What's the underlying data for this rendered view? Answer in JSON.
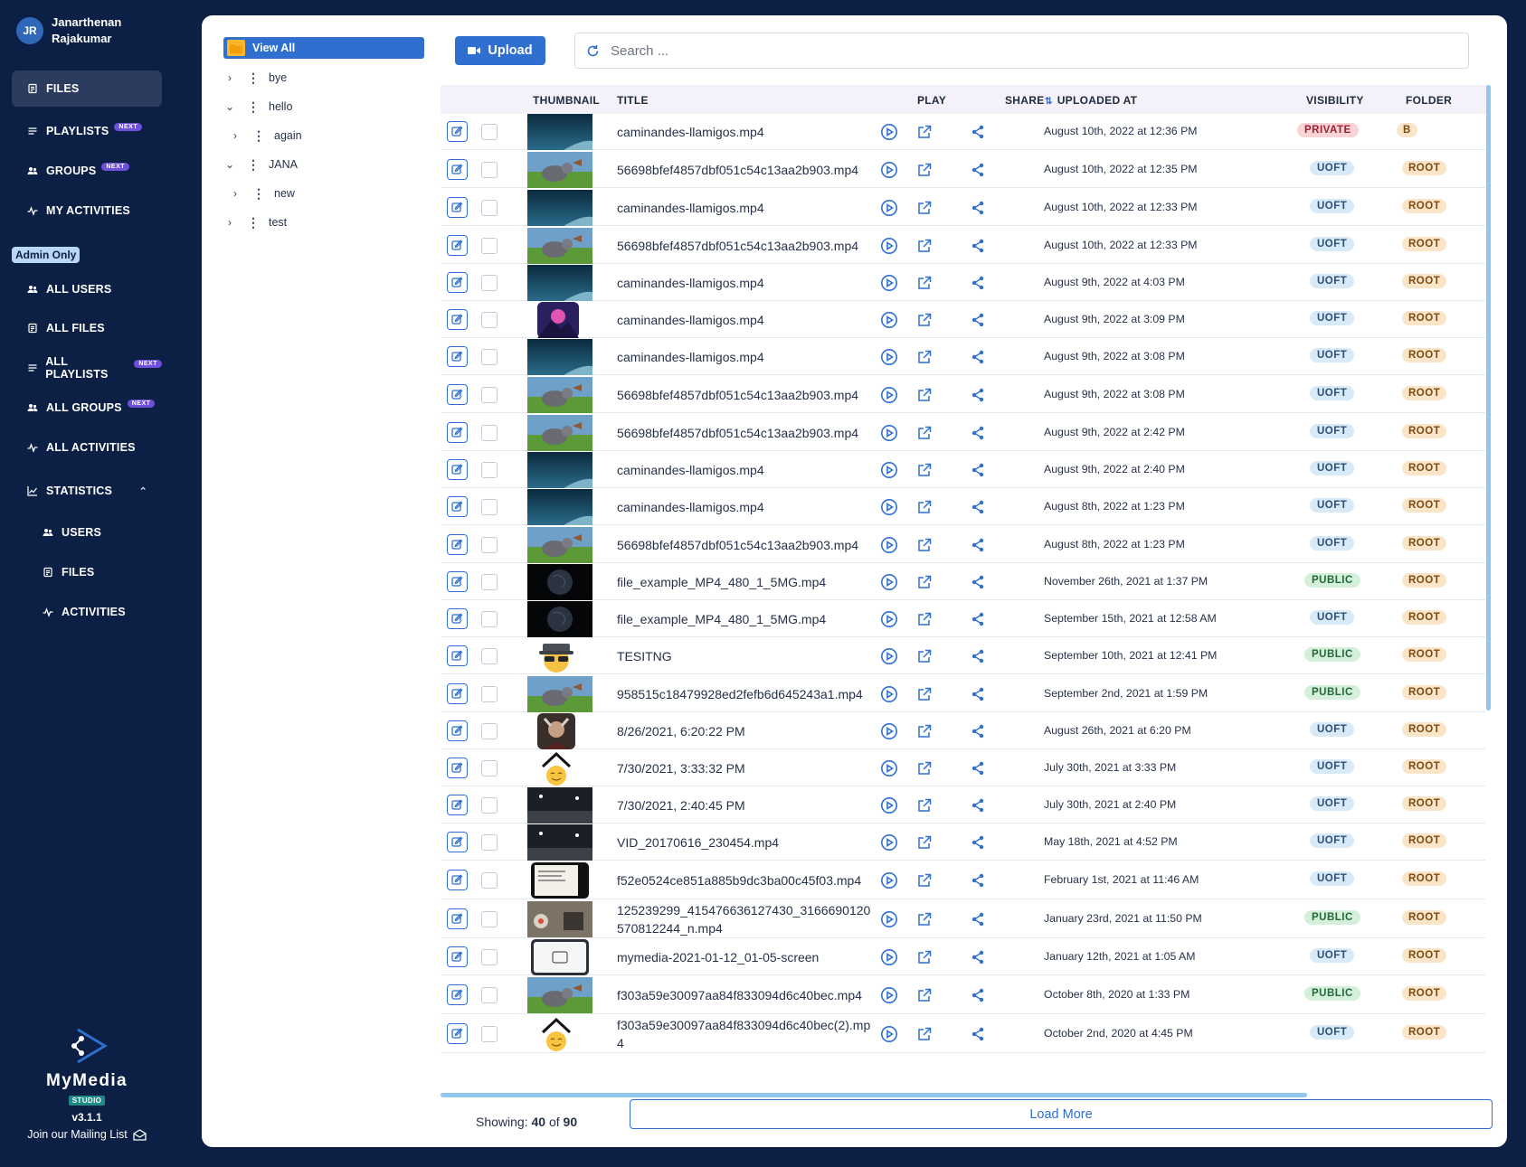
{
  "user": {
    "initials": "JR",
    "name": "Janarthenan Rajakumar"
  },
  "nav": {
    "files": "FILES",
    "playlists": "PLAYLISTS",
    "groups": "GROUPS",
    "my_activities": "MY ACTIVITIES",
    "admin_only": "Admin Only",
    "all_users": "ALL USERS",
    "all_files": "ALL FILES",
    "all_playlists": "ALL PLAYLISTS",
    "all_groups": "ALL GROUPS",
    "all_activities": "ALL ACTIVITIES",
    "statistics": "STATISTICS",
    "stat_users": "USERS",
    "stat_files": "FILES",
    "stat_activities": "ACTIVITIES",
    "next_badge": "NEXT"
  },
  "brand": {
    "name": "MyMedia",
    "studio": "STUDIO",
    "version": "v3.1.1",
    "mailing": "Join our Mailing List"
  },
  "tree": {
    "view_all": "View All",
    "items": [
      {
        "label": "bye",
        "expanded": false,
        "depth": 0
      },
      {
        "label": "hello",
        "expanded": true,
        "depth": 0
      },
      {
        "label": "again",
        "expanded": false,
        "depth": 1
      },
      {
        "label": "JANA",
        "expanded": true,
        "depth": 0
      },
      {
        "label": "new",
        "expanded": false,
        "depth": 1
      },
      {
        "label": "test",
        "expanded": false,
        "depth": 0
      }
    ]
  },
  "toolbar": {
    "upload_label": "Upload",
    "search_placeholder": "Search ..."
  },
  "columns": {
    "thumbnail": "THUMBNAIL",
    "title": "TITLE",
    "play": "PLAY",
    "share": "SHARE",
    "uploaded_at": "UPLOADED AT",
    "visibility": "VISIBILITY",
    "folder": "FOLDER"
  },
  "rows": [
    {
      "title": "caminandes-llamigos.mp4",
      "uploaded": "August 10th, 2022 at 12:36 PM",
      "visibility": "PRIVATE",
      "folder": "B",
      "thumb": "blue"
    },
    {
      "title": "56698bfef4857dbf051c54c13aa2b903.mp4",
      "uploaded": "August 10th, 2022 at 12:35 PM",
      "visibility": "UOFT",
      "folder": "ROOT",
      "thumb": "bunny"
    },
    {
      "title": "caminandes-llamigos.mp4",
      "uploaded": "August 10th, 2022 at 12:33 PM",
      "visibility": "UOFT",
      "folder": "ROOT",
      "thumb": "blue"
    },
    {
      "title": "56698bfef4857dbf051c54c13aa2b903.mp4",
      "uploaded": "August 10th, 2022 at 12:33 PM",
      "visibility": "UOFT",
      "folder": "ROOT",
      "thumb": "bunny"
    },
    {
      "title": "caminandes-llamigos.mp4",
      "uploaded": "August 9th, 2022 at 4:03 PM",
      "visibility": "UOFT",
      "folder": "ROOT",
      "thumb": "blue"
    },
    {
      "title": "caminandes-llamigos.mp4",
      "uploaded": "August 9th, 2022 at 3:09 PM",
      "visibility": "UOFT",
      "folder": "ROOT",
      "thumb": "mountain"
    },
    {
      "title": "caminandes-llamigos.mp4",
      "uploaded": "August 9th, 2022 at 3:08 PM",
      "visibility": "UOFT",
      "folder": "ROOT",
      "thumb": "blue"
    },
    {
      "title": "56698bfef4857dbf051c54c13aa2b903.mp4",
      "uploaded": "August 9th, 2022 at 3:08 PM",
      "visibility": "UOFT",
      "folder": "ROOT",
      "thumb": "bunny"
    },
    {
      "title": "56698bfef4857dbf051c54c13aa2b903.mp4",
      "uploaded": "August 9th, 2022 at 2:42 PM",
      "visibility": "UOFT",
      "folder": "ROOT",
      "thumb": "bunny"
    },
    {
      "title": "caminandes-llamigos.mp4",
      "uploaded": "August 9th, 2022 at 2:40 PM",
      "visibility": "UOFT",
      "folder": "ROOT",
      "thumb": "blue"
    },
    {
      "title": "caminandes-llamigos.mp4",
      "uploaded": "August 8th, 2022 at 1:23 PM",
      "visibility": "UOFT",
      "folder": "ROOT",
      "thumb": "blue"
    },
    {
      "title": "56698bfef4857dbf051c54c13aa2b903.mp4",
      "uploaded": "August 8th, 2022 at 1:23 PM",
      "visibility": "UOFT",
      "folder": "ROOT",
      "thumb": "bunny"
    },
    {
      "title": "file_example_MP4_480_1_5MG.mp4",
      "uploaded": "November 26th, 2021 at 1:37 PM",
      "visibility": "PUBLIC",
      "folder": "ROOT",
      "thumb": "earth"
    },
    {
      "title": "file_example_MP4_480_1_5MG.mp4",
      "uploaded": "September 15th, 2021 at 12:58 AM",
      "visibility": "UOFT",
      "folder": "ROOT",
      "thumb": "earth"
    },
    {
      "title": "TESITNG",
      "uploaded": "September 10th, 2021 at 12:41 PM",
      "visibility": "PUBLIC",
      "folder": "ROOT",
      "thumb": "spy"
    },
    {
      "title": "958515c18479928ed2fefb6d645243a1.mp4",
      "uploaded": "September 2nd, 2021 at 1:59 PM",
      "visibility": "PUBLIC",
      "folder": "ROOT",
      "thumb": "bunny"
    },
    {
      "title": "8/26/2021, 6:20:22 PM",
      "uploaded": "August 26th, 2021 at 6:20 PM",
      "visibility": "UOFT",
      "folder": "ROOT",
      "thumb": "warrior"
    },
    {
      "title": "7/30/2021, 3:33:32 PM",
      "uploaded": "July 30th, 2021 at 3:33 PM",
      "visibility": "UOFT",
      "folder": "ROOT",
      "thumb": "cat"
    },
    {
      "title": "7/30/2021, 2:40:45 PM",
      "uploaded": "July 30th, 2021 at 2:40 PM",
      "visibility": "UOFT",
      "folder": "ROOT",
      "thumb": "night"
    },
    {
      "title": "VID_20170616_230454.mp4",
      "uploaded": "May 18th, 2021 at 4:52 PM",
      "visibility": "UOFT",
      "folder": "ROOT",
      "thumb": "night"
    },
    {
      "title": "f52e0524ce851a885b9dc3ba00c45f03.mp4",
      "uploaded": "February 1st, 2021 at 11:46 AM",
      "visibility": "UOFT",
      "folder": "ROOT",
      "thumb": "paper"
    },
    {
      "title": "125239299_415476636127430_3166690120570812244_n.mp4",
      "uploaded": "January 23rd, 2021 at 11:50 PM",
      "visibility": "PUBLIC",
      "folder": "ROOT",
      "thumb": "room"
    },
    {
      "title": "mymedia-2021-01-12_01-05-screen",
      "uploaded": "January 12th, 2021 at 1:05 AM",
      "visibility": "UOFT",
      "folder": "ROOT",
      "thumb": "screen"
    },
    {
      "title": "f303a59e30097aa84f833094d6c40bec.mp4",
      "uploaded": "October 8th, 2020 at 1:33 PM",
      "visibility": "PUBLIC",
      "folder": "ROOT",
      "thumb": "bunny"
    },
    {
      "title": "f303a59e30097aa84f833094d6c40bec(2).mp4",
      "uploaded": "October 2nd, 2020 at 4:45 PM",
      "visibility": "UOFT",
      "folder": "ROOT",
      "thumb": "cat"
    }
  ],
  "footer": {
    "showing_label": "Showing:",
    "shown": "40",
    "of_label": "of",
    "total": "90",
    "load_more": "Load More"
  },
  "colors": {
    "sidebar": "#0c1f44",
    "accent": "#2f6fd0",
    "active_nav": "#2b3c5e"
  }
}
